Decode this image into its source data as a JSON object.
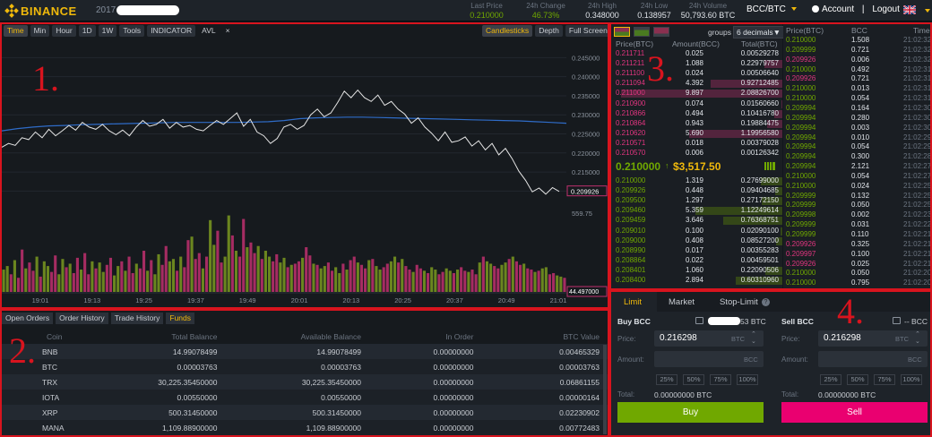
{
  "header": {
    "logo_text": "BINANCE",
    "year": "2017",
    "stats": [
      {
        "label": "Last Price",
        "value": "0.210000",
        "up": true
      },
      {
        "label": "24h Change",
        "value": "46.73%",
        "up": true
      },
      {
        "label": "24h High",
        "value": "0.348000",
        "up": false
      },
      {
        "label": "24h Low",
        "value": "0.138957",
        "up": false
      },
      {
        "label": "24h Volume",
        "value": "50,793.60 BTC",
        "up": false
      }
    ],
    "pair": "BCC/BTC",
    "account": "Account",
    "separator": "|",
    "logout": "Logout"
  },
  "annotations": [
    "1.",
    "2.",
    "3.",
    "4."
  ],
  "chart_toolbar": {
    "left": [
      "Time",
      "Min",
      "Hour",
      "1D",
      "1W",
      "Tools",
      "INDICATOR",
      "AVL",
      "×"
    ],
    "right": [
      "Candlesticks",
      "Depth",
      "Full Screen"
    ]
  },
  "chart_data": {
    "type": "line",
    "price_ticks": [
      "0.245000",
      "0.240000",
      "0.235000",
      "0.230000",
      "0.225000",
      "0.220000",
      "0.215000",
      "0.210000"
    ],
    "last_price_label": "0.209926",
    "volume_ticks": [
      "559.75",
      "44.497000"
    ],
    "time_ticks": [
      "19:01",
      "19:13",
      "19:25",
      "19:37",
      "19:49",
      "20:01",
      "20:13",
      "20:25",
      "20:37",
      "20:49",
      "21:01"
    ],
    "price": [
      0.2215,
      0.2225,
      0.222,
      0.224,
      0.2235,
      0.2255,
      0.224,
      0.2262,
      0.2245,
      0.2258,
      0.2272,
      0.226,
      0.228,
      0.2268,
      0.2262,
      0.2275,
      0.2258,
      0.2248,
      0.226,
      0.2245,
      0.2268,
      0.2285,
      0.227,
      0.2275,
      0.2288,
      0.2265,
      0.228,
      0.2268,
      0.2272,
      0.2262,
      0.2258,
      0.2272,
      0.2285,
      0.2275,
      0.229,
      0.2305,
      0.227,
      0.2288,
      0.2255,
      0.2245,
      0.2225,
      0.2238,
      0.2268,
      0.2275,
      0.2262,
      0.2272,
      0.23,
      0.2315,
      0.2295,
      0.2305,
      0.2332,
      0.2362,
      0.2345,
      0.2365,
      0.2345,
      0.2335,
      0.2352,
      0.2325,
      0.2335,
      0.2315,
      0.2302,
      0.2278,
      0.2292,
      0.2268,
      0.2252,
      0.2232,
      0.2255,
      0.2228,
      0.2232,
      0.2242,
      0.2218,
      0.2232,
      0.2208,
      0.2225,
      0.2195,
      0.2212,
      0.2185,
      0.2152,
      0.2128,
      0.2098,
      0.2108,
      0.2092,
      0.2109,
      0.2099
    ],
    "moving_average": [
      0.2258,
      0.2264,
      0.2268,
      0.2271,
      0.2272,
      0.2274,
      0.2275,
      0.2276,
      0.2277,
      0.2278,
      0.2279,
      0.228,
      0.228,
      0.228,
      0.228,
      0.228,
      0.2281,
      0.2282,
      0.2285,
      0.229,
      0.2292,
      0.2293,
      0.2294,
      0.2294,
      0.2293,
      0.2292,
      0.2291,
      0.229,
      0.2289,
      0.2288,
      0.2287,
      0.2286,
      0.2285,
      0.2284,
      0.2282,
      0.228,
      0.2278
    ],
    "volume": [
      190,
      220,
      150,
      270,
      120,
      360,
      200,
      250,
      180,
      300,
      130,
      260,
      220,
      170,
      310,
      150,
      280,
      210,
      240,
      160,
      290,
      190,
      330,
      150,
      260,
      200,
      250,
      170,
      230,
      290,
      140,
      220,
      260,
      180,
      300,
      160,
      240,
      200,
      350,
      180,
      270,
      150,
      320,
      230,
      390,
      260,
      280,
      180,
      300,
      210,
      440,
      470,
      280,
      330,
      200,
      300,
      610,
      400,
      520,
      250,
      300,
      650,
      480,
      350,
      300,
      620,
      380,
      420,
      330,
      390,
      280,
      350,
      300,
      260,
      320,
      250,
      290,
      210,
      230,
      240,
      260,
      290,
      380,
      310,
      240,
      230,
      200,
      220,
      250,
      180,
      210,
      160,
      240,
      190,
      270,
      300,
      250,
      230,
      200,
      270,
      280,
      220,
      190,
      210,
      240,
      260,
      300,
      250,
      280,
      220,
      190,
      170,
      230,
      200,
      180,
      160,
      210,
      190,
      150,
      170,
      200,
      180,
      160,
      190,
      210,
      180,
      170,
      190,
      150,
      250,
      300,
      260,
      240,
      220,
      200,
      230,
      250,
      280,
      300,
      260,
      230,
      240,
      200,
      190,
      170,
      180,
      200,
      210,
      150,
      160,
      140,
      130,
      120
    ]
  },
  "balances": {
    "tabs": [
      "Open Orders",
      "Order History",
      "Trade History",
      "Funds"
    ],
    "headers": [
      "Coin",
      "Total Balance",
      "Available Balance",
      "In Order",
      "BTC Value"
    ],
    "rows": [
      [
        "BNB",
        "14.99078499",
        "14.99078499",
        "0.00000000",
        "0.00465329"
      ],
      [
        "BTC",
        "0.00003763",
        "0.00003763",
        "0.00000000",
        "0.00003763"
      ],
      [
        "TRX",
        "30,225.35450000",
        "30,225.35450000",
        "0.00000000",
        "0.06861155"
      ],
      [
        "IOTA",
        "0.00550000",
        "0.00550000",
        "0.00000000",
        "0.00000164"
      ],
      [
        "XRP",
        "500.31450000",
        "500.31450000",
        "0.00000000",
        "0.02230902"
      ],
      [
        "MANA",
        "1,109.88900000",
        "1,109.88900000",
        "0.00000000",
        "0.00772483"
      ]
    ]
  },
  "orderbook": {
    "groups_label": "groups",
    "decimals": "6 decimals",
    "headers": [
      "Price(BTC)",
      "Amount(BCC)",
      "Total(BTC)"
    ],
    "asks": [
      [
        "0.211711",
        "0.025",
        "0.00529278"
      ],
      [
        "0.211211",
        "1.088",
        "0.22979757"
      ],
      [
        "0.211100",
        "0.024",
        "0.00506640"
      ],
      [
        "0.211094",
        "4.392",
        "0.92712485"
      ],
      [
        "0.211000",
        "9.897",
        "2.08826700"
      ],
      [
        "0.210900",
        "0.074",
        "0.01560660"
      ],
      [
        "0.210866",
        "0.494",
        "0.10416780"
      ],
      [
        "0.210864",
        "0.943",
        "0.19884475"
      ],
      [
        "0.210620",
        "5.690",
        "1.19956580"
      ],
      [
        "0.210571",
        "0.018",
        "0.00379028"
      ],
      [
        "0.210570",
        "0.006",
        "0.00126342"
      ]
    ],
    "last_price": "0.210000",
    "last_usd": "$3,517.50",
    "bids": [
      [
        "0.210000",
        "1.319",
        "0.27699000"
      ],
      [
        "0.209926",
        "0.448",
        "0.09404685"
      ],
      [
        "0.209500",
        "1.297",
        "0.27172150"
      ],
      [
        "0.209460",
        "5.359",
        "1.12249614"
      ],
      [
        "0.209459",
        "3.646",
        "0.76368751"
      ],
      [
        "0.209010",
        "0.100",
        "0.02090100"
      ],
      [
        "0.209000",
        "0.408",
        "0.08527200"
      ],
      [
        "0.208990",
        "0.017",
        "0.00355283"
      ],
      [
        "0.208864",
        "0.022",
        "0.00459501"
      ],
      [
        "0.208401",
        "1.060",
        "0.22090506"
      ],
      [
        "0.208400",
        "2.894",
        "0.60310960"
      ]
    ]
  },
  "trades": {
    "headers": [
      "Price(BTC)",
      "BCC",
      "Time"
    ],
    "rows": [
      [
        "0.210000",
        "1.508",
        "21:02:32",
        "buy"
      ],
      [
        "0.209999",
        "0.721",
        "21:02:32",
        "buy"
      ],
      [
        "0.209926",
        "0.006",
        "21:02:32",
        "sell"
      ],
      [
        "0.210000",
        "0.492",
        "21:02:31",
        "buy"
      ],
      [
        "0.209926",
        "0.721",
        "21:02:31",
        "sell"
      ],
      [
        "0.210000",
        "0.013",
        "21:02:31",
        "buy"
      ],
      [
        "0.210000",
        "0.054",
        "21:02:31",
        "buy"
      ],
      [
        "0.209994",
        "0.164",
        "21:02:30",
        "buy"
      ],
      [
        "0.209994",
        "0.280",
        "21:02:30",
        "buy"
      ],
      [
        "0.209994",
        "0.003",
        "21:02:30",
        "buy"
      ],
      [
        "0.209994",
        "0.010",
        "21:02:29",
        "buy"
      ],
      [
        "0.209994",
        "0.054",
        "21:02:29",
        "buy"
      ],
      [
        "0.209994",
        "0.300",
        "21:02:28",
        "buy"
      ],
      [
        "0.209994",
        "2.121",
        "21:02:27",
        "buy"
      ],
      [
        "0.210000",
        "0.054",
        "21:02:27",
        "buy"
      ],
      [
        "0.210000",
        "0.024",
        "21:02:25",
        "buy"
      ],
      [
        "0.209999",
        "0.132",
        "21:02:25",
        "buy"
      ],
      [
        "0.209999",
        "0.050",
        "21:02:25",
        "buy"
      ],
      [
        "0.209998",
        "0.002",
        "21:02:23",
        "buy"
      ],
      [
        "0.209999",
        "0.031",
        "21:02:22",
        "buy"
      ],
      [
        "0.209999",
        "0.110",
        "21:02:21",
        "buy"
      ],
      [
        "0.209926",
        "0.325",
        "21:02:21",
        "sell"
      ],
      [
        "0.209997",
        "0.100",
        "21:02:21",
        "sell"
      ],
      [
        "0.209926",
        "0.025",
        "21:02:21",
        "sell"
      ],
      [
        "0.210000",
        "0.050",
        "21:02:20",
        "buy"
      ],
      [
        "0.210000",
        "0.795",
        "21:02:20",
        "buy"
      ]
    ]
  },
  "order_form": {
    "tabs": [
      "Limit",
      "Market",
      "Stop-Limit"
    ],
    "buy": {
      "title": "Buy BCC",
      "balance_suffix": "53 BTC",
      "price": "0.216298",
      "price_unit": "BTC",
      "amount_unit": "BCC",
      "total": "0.00000000 BTC",
      "button": "Buy"
    },
    "sell": {
      "title": "Sell BCC",
      "balance": "-- BCC",
      "price": "0.216298",
      "price_unit": "BTC",
      "amount_unit": "BCC",
      "total": "0.00000000 BTC",
      "button": "Sell"
    },
    "labels": {
      "price": "Price:",
      "amount": "Amount:",
      "total": "Total:"
    },
    "percents": [
      "25%",
      "50%",
      "75%",
      "100%"
    ]
  }
}
